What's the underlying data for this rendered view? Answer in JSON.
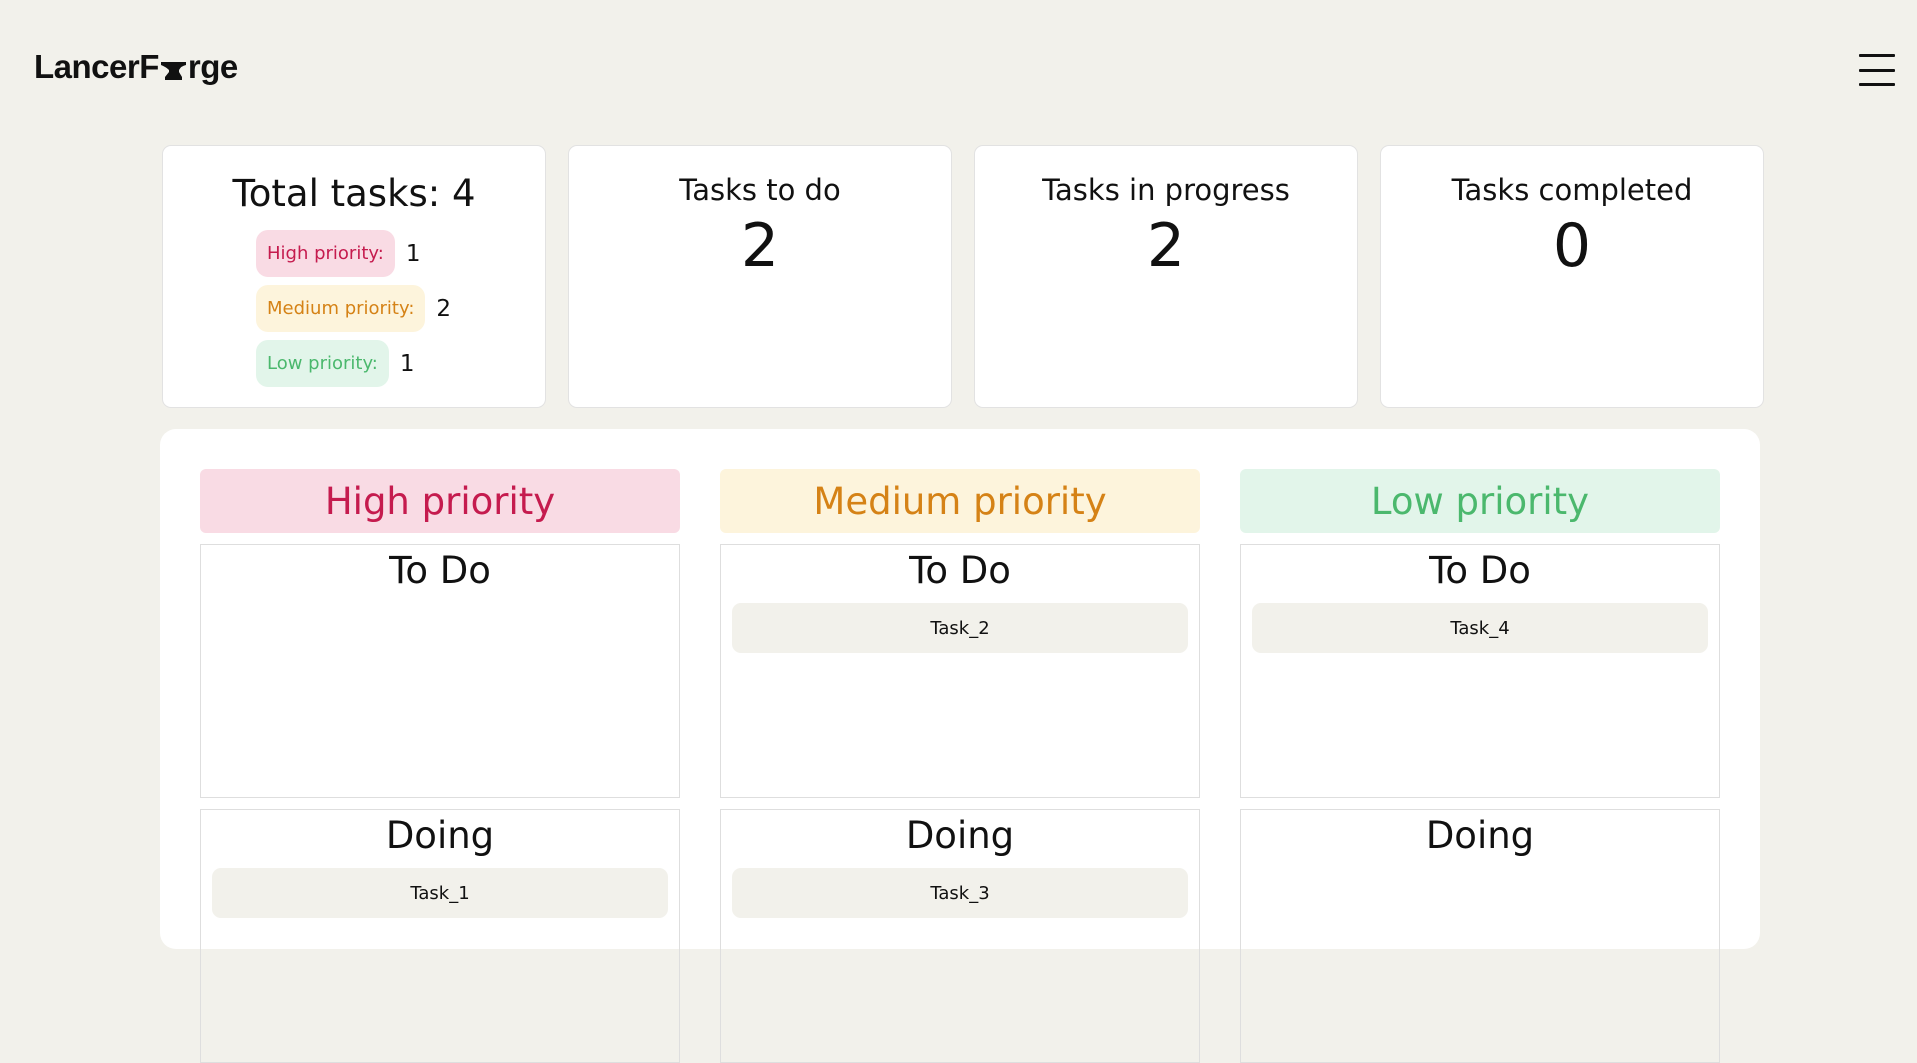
{
  "header": {
    "logo_before": "LancerF",
    "logo_after": "rge",
    "menu_icon": "hamburger-menu-icon"
  },
  "stats": {
    "total_label": "Total tasks:",
    "total_value": "4",
    "high_label": "High priority:",
    "high_count": "1",
    "medium_label": "Medium priority:",
    "medium_count": "2",
    "low_label": "Low priority:",
    "low_count": "1",
    "todo_label": "Tasks to do",
    "todo_value": "2",
    "progress_label": "Tasks in progress",
    "progress_value": "2",
    "completed_label": "Tasks completed",
    "completed_value": "0"
  },
  "colors": {
    "high": "#c51b4e",
    "high_bg": "#f9dbe4",
    "medium": "#d58216",
    "medium_bg": "#fdf4dc",
    "low": "#4bb86d",
    "low_bg": "#e2f5ea",
    "page_bg": "#f2f1eb"
  },
  "board": {
    "high": {
      "title": "High priority",
      "todo_title": "To Do",
      "doing_title": "Doing",
      "doing_tasks": [
        "Task_1"
      ]
    },
    "medium": {
      "title": "Medium priority",
      "todo_title": "To Do",
      "todo_tasks": [
        "Task_2"
      ],
      "doing_title": "Doing",
      "doing_tasks": [
        "Task_3"
      ]
    },
    "low": {
      "title": "Low priority",
      "todo_title": "To Do",
      "todo_tasks": [
        "Task_4"
      ],
      "doing_title": "Doing"
    }
  }
}
